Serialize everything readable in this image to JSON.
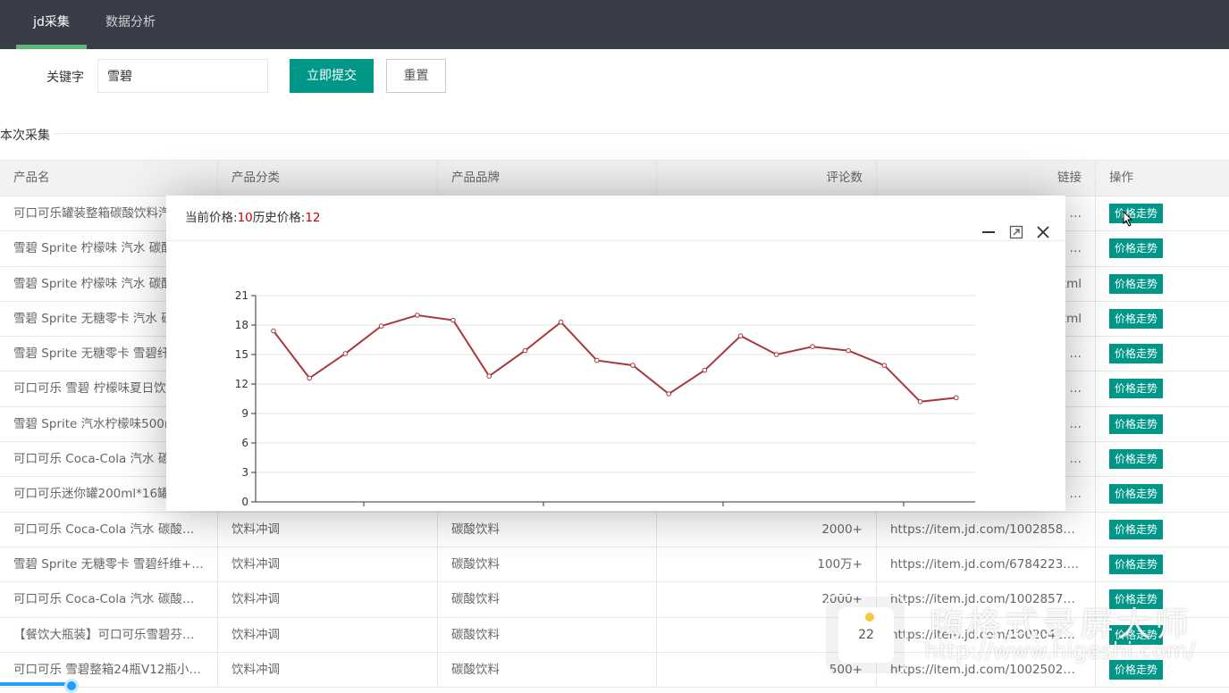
{
  "nav": {
    "tabs": [
      {
        "label": "jd采集",
        "active": true
      },
      {
        "label": "数据分析",
        "active": false
      }
    ]
  },
  "form": {
    "keyword_label": "关键字",
    "keyword_value": "雪碧",
    "submit_label": "立即提交",
    "reset_label": "重置"
  },
  "section_title": "本次采集",
  "table": {
    "headers": [
      "产品名",
      "产品分类",
      "产品品牌",
      "评论数",
      "链接",
      "操作"
    ],
    "rows": [
      {
        "name": "可口可乐罐装整箱碳酸饮料汽水",
        "category": "",
        "brand": "",
        "comments": "",
        "link": "…",
        "action": "价格走势"
      },
      {
        "name": "雪碧 Sprite 柠檬味 汽水 碳酸",
        "category": "",
        "brand": "",
        "comments": "",
        "link": "…",
        "action": "价格走势"
      },
      {
        "name": "雪碧 Sprite 柠檬味 汽水 碳酸",
        "category": "",
        "brand": "",
        "comments": "",
        "link": "tml",
        "action": "价格走势"
      },
      {
        "name": "雪碧 Sprite 无糖零卡 汽水 碳",
        "category": "",
        "brand": "",
        "comments": "",
        "link": "tml",
        "action": "价格走势"
      },
      {
        "name": "雪碧 Sprite 无糖零卡 雪碧纤",
        "category": "",
        "brand": "",
        "comments": "",
        "link": "…",
        "action": "价格走势"
      },
      {
        "name": "可口可乐 雪碧 柠檬味夏日饮",
        "category": "",
        "brand": "",
        "comments": "",
        "link": "…",
        "action": "价格走势"
      },
      {
        "name": "雪碧 Sprite 汽水柠檬味500m",
        "category": "",
        "brand": "",
        "comments": "",
        "link": "…",
        "action": "价格走势"
      },
      {
        "name": "可口可乐 Coca-Cola 汽水 碳",
        "category": "",
        "brand": "",
        "comments": "",
        "link": "…",
        "action": "价格走势"
      },
      {
        "name": "可口可乐迷你罐200ml*16罐",
        "category": "",
        "brand": "",
        "comments": "",
        "link": "…",
        "action": "价格走势"
      },
      {
        "name": "可口可乐 Coca-Cola 汽水 碳酸…",
        "category": "饮料冲调",
        "brand": "碳酸饮料",
        "comments": "2000+",
        "link": "https://item.jd.com/100285895…",
        "action": "价格走势"
      },
      {
        "name": "雪碧 Sprite 无糖零卡 雪碧纤维+…",
        "category": "饮料冲调",
        "brand": "碳酸饮料",
        "comments": "100万+",
        "link": "https://item.jd.com/6784223.html",
        "action": "价格走势"
      },
      {
        "name": "可口可乐 Coca-Cola 汽水 碳酸…",
        "category": "饮料冲调",
        "brand": "碳酸饮料",
        "comments": "2000+",
        "link": "https://item.jd.com/100285787…",
        "action": "价格走势"
      },
      {
        "name": "【餐饮大瓶装】可口可乐雪碧芬…",
        "category": "饮料冲调",
        "brand": "碳酸饮料",
        "comments": "",
        "link": "https://item.jd.com/10020418…",
        "action": "价格走势"
      },
      {
        "name": "可口可乐 雪碧整箱24瓶V12瓶小…",
        "category": "饮料冲调",
        "brand": "碳酸饮料",
        "comments": "500+",
        "link": "https://item.jd.com/100250298…",
        "action": "价格走势"
      }
    ]
  },
  "modal": {
    "current_label": "当前价格:",
    "current_value": "10",
    "history_label": "历史价格:",
    "history_value": "12"
  },
  "chart_data": {
    "type": "line",
    "title": "",
    "xlabel": "",
    "ylabel": "",
    "ylim": [
      0,
      21
    ],
    "yticks": [
      0,
      3,
      6,
      9,
      12,
      15,
      18,
      21
    ],
    "grid": true,
    "series": [
      {
        "values": [
          17.4,
          12.6,
          15.1,
          17.9,
          19.0,
          18.5,
          12.8,
          15.4,
          18.3,
          14.4,
          13.9,
          11.0,
          13.4,
          16.9,
          15.0,
          15.8,
          15.4,
          13.9,
          10.2,
          10.6
        ],
        "color": "#a8383b"
      }
    ]
  },
  "recorder": {
    "counter": "22",
    "watermark_title": "嗨格式录屏大师",
    "watermark_url": "http://www.higeshi.com/"
  },
  "colors": {
    "nav_bg": "#393d49",
    "accent": "#009688",
    "nav_indicator": "#5fb878",
    "price_red": "#cc0000"
  }
}
